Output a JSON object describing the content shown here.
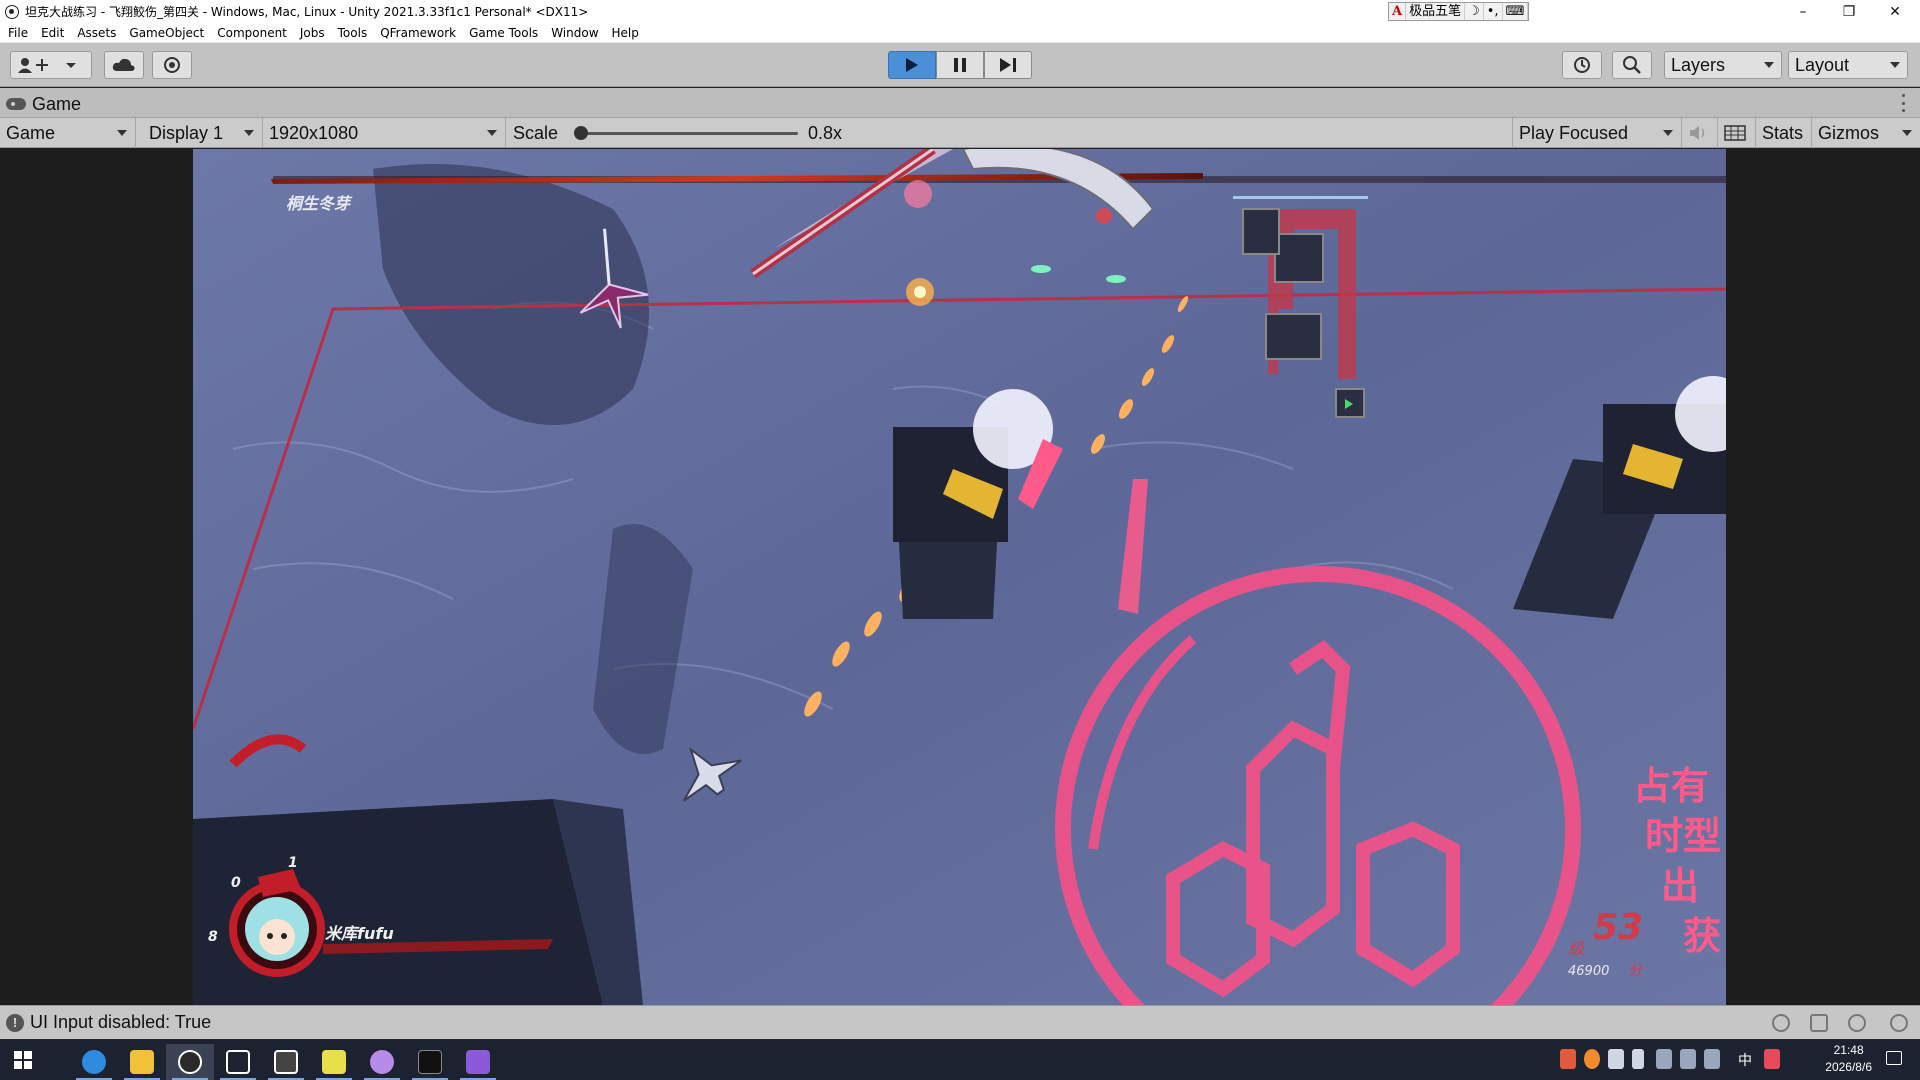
{
  "window": {
    "title": "坦克大战练习 - 飞翔鲛伤_第四关 - Windows, Mac, Linux - Unity 2021.3.33f1c1 Personal* <DX11>",
    "minimize": "–",
    "maximize": "❐",
    "close": "✕"
  },
  "ime": {
    "a": "A",
    "name": "极品五笔",
    "moon": "☽",
    "dots": "•,",
    "kbd": "⌨"
  },
  "menu": [
    "File",
    "Edit",
    "Assets",
    "GameObject",
    "Component",
    "Jobs",
    "Tools",
    "QFramework",
    "Game Tools",
    "Window",
    "Help"
  ],
  "toolbar": {
    "layers": "Layers",
    "layout": "Layout"
  },
  "tab": {
    "label": "Game"
  },
  "gamebar": {
    "mode": "Game",
    "display": "Display 1",
    "resolution": "1920x1080",
    "scale_label": "Scale",
    "scale_value": "0.8x",
    "play_mode": "Play Focused",
    "stats": "Stats",
    "gizmos": "Gizmos"
  },
  "game": {
    "boss_name": "桐生冬芽",
    "player_name": "米库fufu",
    "hud_numbers": {
      "top": "1",
      "left": "0",
      "bottom": "8"
    },
    "banner_lines": [
      "占有",
      "时型",
      "出",
      "获"
    ],
    "score_big": "53",
    "score_small": "46900",
    "score_level": "级",
    "score_unit": "分",
    "colors": {
      "ground": "#5e6898",
      "pink": "#ff4f86",
      "boss_bar": "#cf3a22"
    }
  },
  "status": {
    "text": "UI Input disabled: True"
  },
  "taskbar": {
    "time": "21:48",
    "date": "2026/8/6",
    "ime_cn": "中"
  }
}
